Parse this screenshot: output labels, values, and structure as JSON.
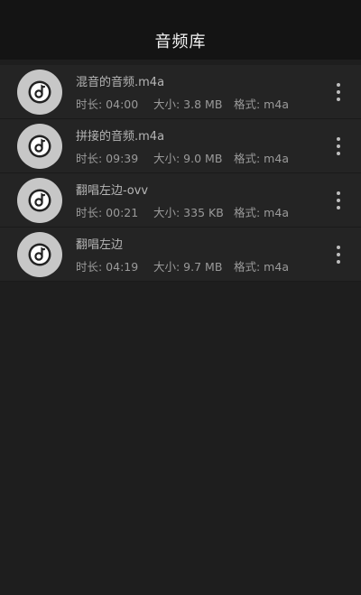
{
  "header": {
    "title": "音频库"
  },
  "items": [
    {
      "name": "混音的音频.m4a",
      "duration": "时长: 04:00",
      "size": "大小: 3.8 MB",
      "format": "格式: m4a"
    },
    {
      "name": "拼接的音频.m4a",
      "duration": "时长: 09:39",
      "size": "大小: 9.0 MB",
      "format": "格式: m4a"
    },
    {
      "name": "翻唱左边-ovv",
      "duration": "时长: 00:21",
      "size": "大小: 335 KB",
      "format": "格式: m4a"
    },
    {
      "name": "翻唱左边",
      "duration": "时长: 04:19",
      "size": "大小: 9.7 MB",
      "format": "格式: m4a"
    }
  ],
  "icons": {
    "item_icon": "music-note-disc-icon",
    "more": "more-vertical-icon"
  },
  "colors": {
    "background": "#1e1e1e",
    "header": "#141414",
    "row": "#242424",
    "disc": "#c7c7c7"
  }
}
